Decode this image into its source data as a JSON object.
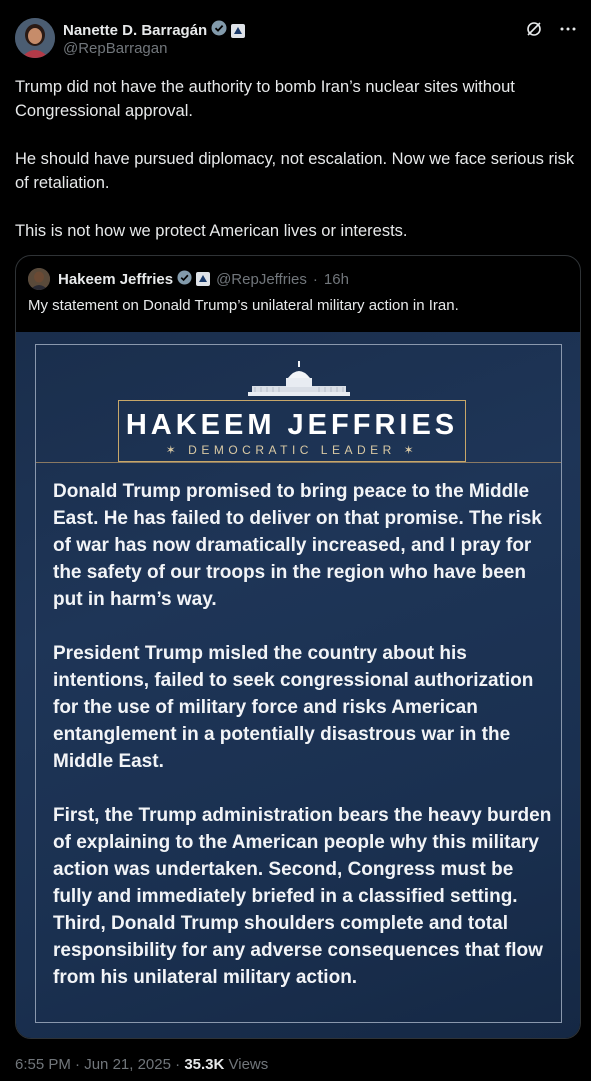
{
  "author": {
    "name": "Nanette D. Barragán",
    "handle": "@RepBarragan"
  },
  "tweet": {
    "paragraphs": [
      "Trump did not have the authority to bomb Iran’s nuclear sites without Congressional approval.",
      "He should have pursued diplomacy, not escalation. Now we face serious risk of retaliation.",
      "This is not how we protect American lives or interests."
    ]
  },
  "quote": {
    "name": "Hakeem Jeffries",
    "handle": "@RepJeffries",
    "separator": "·",
    "time": "16h",
    "text": "My statement on Donald Trump’s unilateral military action in Iran.",
    "image": {
      "title": "HAKEEM JEFFRIES",
      "subtitle": "DEMOCRATIC LEADER",
      "paragraphs": [
        "Donald Trump promised to bring peace to the Middle East. He has failed to deliver on that promise. The risk of war has now dramatically increased, and I pray for the safety of our troops in the region who have been put in harm’s way.",
        "President Trump misled the country about his intentions, failed to seek congressional authorization for the use of military force and risks American entanglement in a potentially disastrous war in the Middle East.",
        "First, the Trump administration bears the heavy burden of explaining to the American people why this military action was undertaken. Second, Congress must be fully and immediately briefed in a classified setting. Third, Donald Trump shoulders complete and total responsibility for any adverse consequences that flow from his unilateral military action."
      ]
    }
  },
  "footer": {
    "time": "6:55 PM",
    "date": "Jun 21, 2025",
    "separator": "·",
    "views_count": "35.3K",
    "views_label": "Views"
  },
  "colors": {
    "background": "#000000",
    "text": "#e7e9ea",
    "muted": "#71767b",
    "verified": "#829aab",
    "gold": "#c7a769",
    "navy": "#1e3557"
  },
  "icons": [
    "verified-badge-icon",
    "government-badge-icon",
    "grok-icon",
    "more-icon",
    "capitol-icon",
    "star-icon"
  ]
}
